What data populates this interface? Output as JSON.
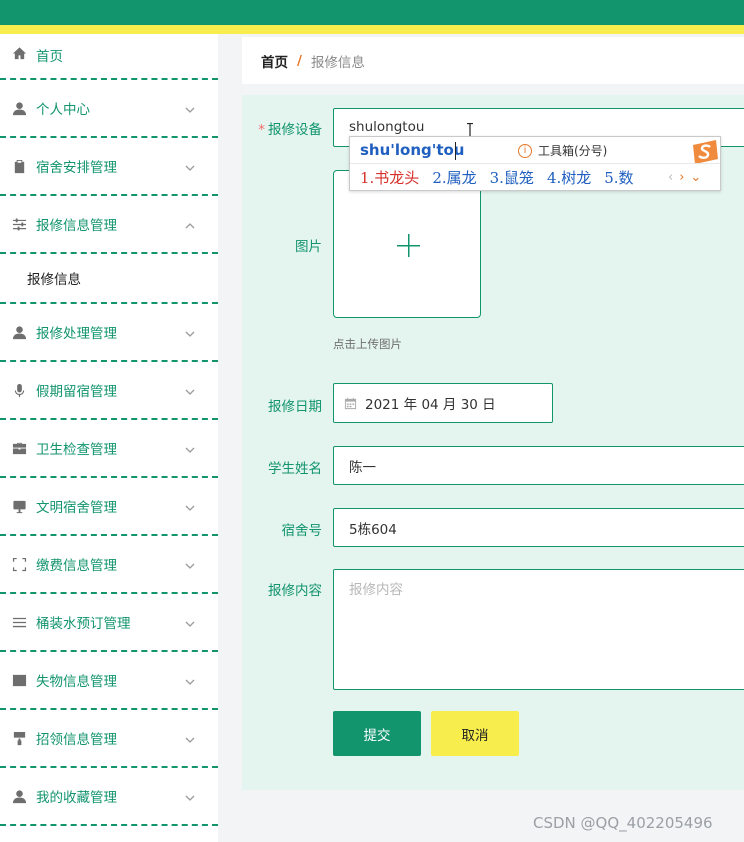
{
  "colors": {
    "accent": "#12946d",
    "stripe": "#f7ee4d",
    "required": "#f56c6c",
    "breadcrumb_sep": "#e8792e"
  },
  "sidebar": {
    "items": [
      {
        "label": "首页",
        "icon": "home-icon",
        "chevron": "none"
      },
      {
        "label": "个人中心",
        "icon": "user-icon",
        "chevron": "down"
      },
      {
        "label": "宿舍安排管理",
        "icon": "clipboard-icon",
        "chevron": "down"
      },
      {
        "label": "报修信息管理",
        "icon": "sliders-icon",
        "chevron": "up",
        "expanded": true,
        "children": [
          {
            "label": "报修信息"
          }
        ]
      },
      {
        "label": "报修处理管理",
        "icon": "user-icon",
        "chevron": "down"
      },
      {
        "label": "假期留宿管理",
        "icon": "microphone-icon",
        "chevron": "down"
      },
      {
        "label": "卫生检查管理",
        "icon": "briefcase-icon",
        "chevron": "down"
      },
      {
        "label": "文明宿舍管理",
        "icon": "monitor-icon",
        "chevron": "down"
      },
      {
        "label": "缴费信息管理",
        "icon": "scan-icon",
        "chevron": "down"
      },
      {
        "label": "桶装水预订管理",
        "icon": "list-icon",
        "chevron": "down"
      },
      {
        "label": "失物信息管理",
        "icon": "chart-icon",
        "chevron": "down"
      },
      {
        "label": "招领信息管理",
        "icon": "paint-roller-icon",
        "chevron": "down"
      },
      {
        "label": "我的收藏管理",
        "icon": "user-icon",
        "chevron": "down"
      }
    ]
  },
  "breadcrumb": {
    "home": "首页",
    "separator": "/",
    "current": "报修信息"
  },
  "form": {
    "device": {
      "label": "报修设备",
      "value": "shulongtou",
      "required": true
    },
    "image": {
      "label": "图片",
      "hint": "点击上传图片"
    },
    "date": {
      "label": "报修日期",
      "value": "2021 年 04 月 30 日"
    },
    "student": {
      "label": "学生姓名",
      "value": "陈一"
    },
    "dorm": {
      "label": "宿舍号",
      "value": "5栋604"
    },
    "content": {
      "label": "报修内容",
      "placeholder": "报修内容"
    },
    "submit_label": "提交",
    "cancel_label": "取消"
  },
  "ime": {
    "pinyin": "shu'long'tou",
    "toolbox": "工具箱(分号)",
    "candidates": [
      "1.书龙头",
      "2.属龙",
      "3.鼠笼",
      "4.树龙",
      "5.数"
    ],
    "logo": "sogou-s-icon"
  },
  "watermark": "CSDN @QQ_402205496"
}
